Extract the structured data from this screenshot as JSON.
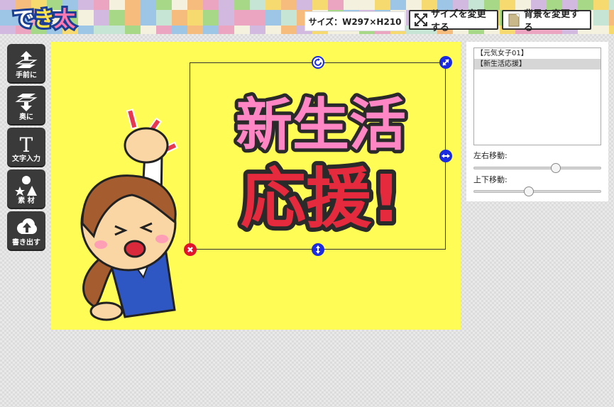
{
  "header": {
    "size_label": "サイズ：W297×H210",
    "size_button_label": "サイズを変更する",
    "background_button_label": "背景を変更する"
  },
  "toolbar": {
    "bring_front_label": "手前に",
    "send_back_label": "奥に",
    "text_input_label": "文字入力",
    "material_label": "素 材",
    "export_label": "書き出す",
    "text_tool_glyph": "T"
  },
  "layers": {
    "items": [
      "【元気女子01】",
      "【新生活応援】"
    ],
    "selected_index": 1
  },
  "controls": {
    "horizontal_label": "左右移動:",
    "vertical_label": "上下移動:",
    "horizontal_value": 0.65,
    "vertical_value": 0.42
  },
  "colors": {
    "canvas_bg": "#fffc55",
    "toolbar_bg": "#3a3a3a",
    "handle_blue": "#1a2be0",
    "handle_red": "#e0142b"
  }
}
